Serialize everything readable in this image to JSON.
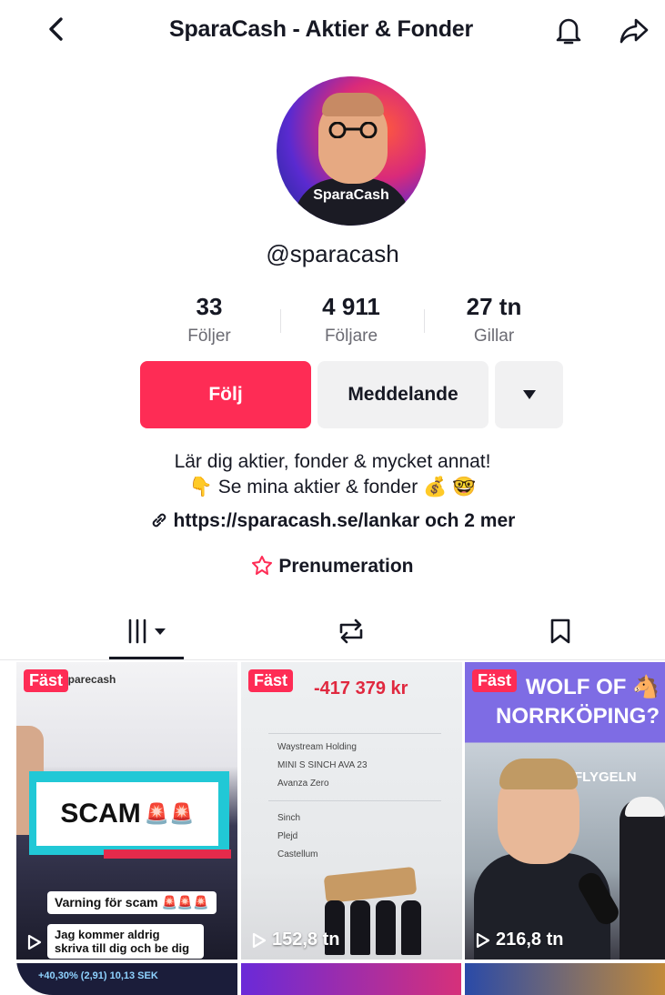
{
  "header": {
    "title": "SparaCash - Aktier & Fonder"
  },
  "profile": {
    "avatar_brand": "SparaCash",
    "handle": "@sparacash",
    "stats": [
      {
        "value": "33",
        "label": "Följer"
      },
      {
        "value": "4 911",
        "label": "Följare"
      },
      {
        "value": "27 tn",
        "label": "Gillar"
      }
    ],
    "buttons": {
      "follow": "Följ",
      "message": "Meddelande"
    },
    "bio_line1": "Lär dig aktier, fonder & mycket annat!",
    "bio_line2": "Se mina aktier & fonder",
    "bio_emoji_point": "👇",
    "bio_emoji_bag": "💰",
    "bio_emoji_nerd": "🤓",
    "link_text": "https://sparacash.se/lankar och 2 mer",
    "subscription": "Prenumeration"
  },
  "videos": [
    {
      "pinned": "Fäst",
      "overlay": "SCAM",
      "overlay_emoji": "🚨🚨",
      "caption1": "Varning för scam 🚨🚨🚨",
      "caption2": "Jag kommer aldrig skriva till dig och be dig",
      "fake_name": "sparecash",
      "footer_text": "+40,30% (2,91) 10,13 SEK",
      "views": ""
    },
    {
      "pinned": "Fäst",
      "headline": "-417 379 kr",
      "rows": [
        "Waystream Holding",
        "MINI S SINCH AVA 23",
        "Avanza Zero",
        "Sinch",
        "Plejd",
        "Castellum"
      ],
      "views": "152,8 tn"
    },
    {
      "pinned": "Fäst",
      "headline": "WOLF OF 🐴 NORRKÖPING?",
      "sign": "FLYGELN",
      "views": "216,8 tn"
    }
  ],
  "colors": {
    "accent": "#fe2c55",
    "secondary_bg": "#f1f1f2",
    "text": "#161823"
  }
}
